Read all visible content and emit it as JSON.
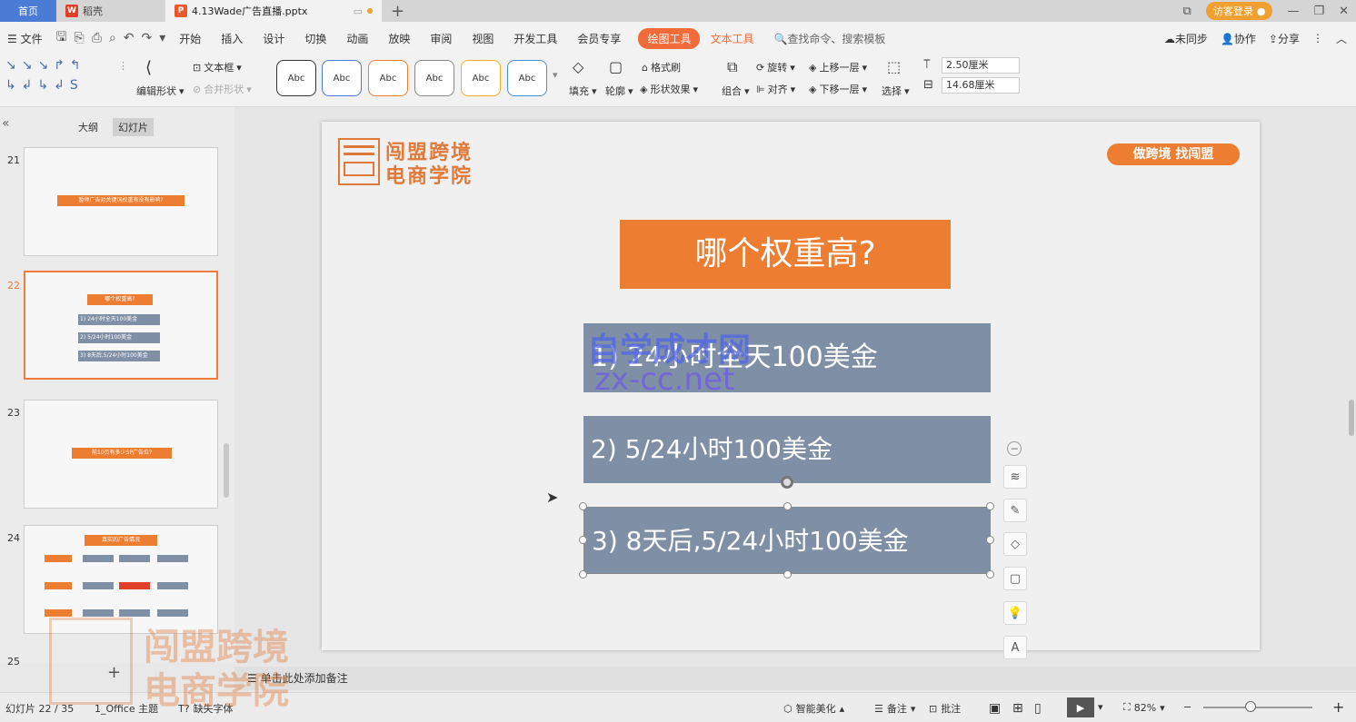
{
  "tabs": {
    "home": "首页",
    "doc": "稻壳",
    "active": "4.13Wade广告直播.pptx",
    "login": "访客登录"
  },
  "menu": {
    "file": "文件",
    "items": [
      "开始",
      "插入",
      "设计",
      "切换",
      "动画",
      "放映",
      "审阅",
      "视图",
      "开发工具",
      "会员专享"
    ],
    "draw_tools": "绘图工具",
    "text_tools": "文本工具",
    "search": "查找命令、搜索模板",
    "sync": "未同步",
    "collab": "协作",
    "share": "分享"
  },
  "ribbon": {
    "textbox": "文本框",
    "edit_shape": "编辑形状",
    "merge_shape": "合并形状",
    "abc": "Abc",
    "fill": "填充",
    "outline": "轮廓",
    "format_brush": "格式刷",
    "shape_effect": "形状效果",
    "group": "组合",
    "rotate": "旋转",
    "align": "对齐",
    "up_layer": "上移一层",
    "down_layer": "下移一层",
    "select": "选择",
    "height": "2.50厘米",
    "width": "14.68厘米"
  },
  "leftpanel": {
    "outline_tab": "大纲",
    "slides_tab": "幻灯片",
    "thumbs": [
      {
        "num": "21",
        "text": "暂停广告对关键词权重有没有影响?"
      },
      {
        "num": "22",
        "title": "哪个权重高?",
        "items": [
          "1) 24小时全天100美金",
          "2) 5/24小时100美金",
          "3) 8天后,5/24小时100美金"
        ]
      },
      {
        "num": "23",
        "text": "前10页有多少SP广告位?"
      },
      {
        "num": "24",
        "text": "真实的广告情况"
      },
      {
        "num": "25"
      }
    ]
  },
  "slide": {
    "logo_line1": "闯盟跨境",
    "logo_line2": "电商学院",
    "tagline": "做跨境 找闯盟",
    "title": "哪个权重高?",
    "options": [
      "1) 24小时全天100美金",
      "2) 5/24小时100美金",
      "3) 8天后,5/24小时100美金"
    ],
    "watermark1": "自学成才网",
    "watermark2": "zx-cc.net",
    "colors": {
      "orange": "#ed7d31",
      "gray": "#7f8fa6"
    }
  },
  "notes": "单击此处添加备注",
  "status": {
    "slide_count": "幻灯片 22 / 35",
    "theme": "1_Office 主题",
    "font": "缺失字体",
    "beautify": "智能美化",
    "notes_btn": "备注",
    "comment": "批注",
    "zoom": "82%"
  },
  "overlay": {
    "line1": "闯盟跨境",
    "line2": "电商学院"
  }
}
